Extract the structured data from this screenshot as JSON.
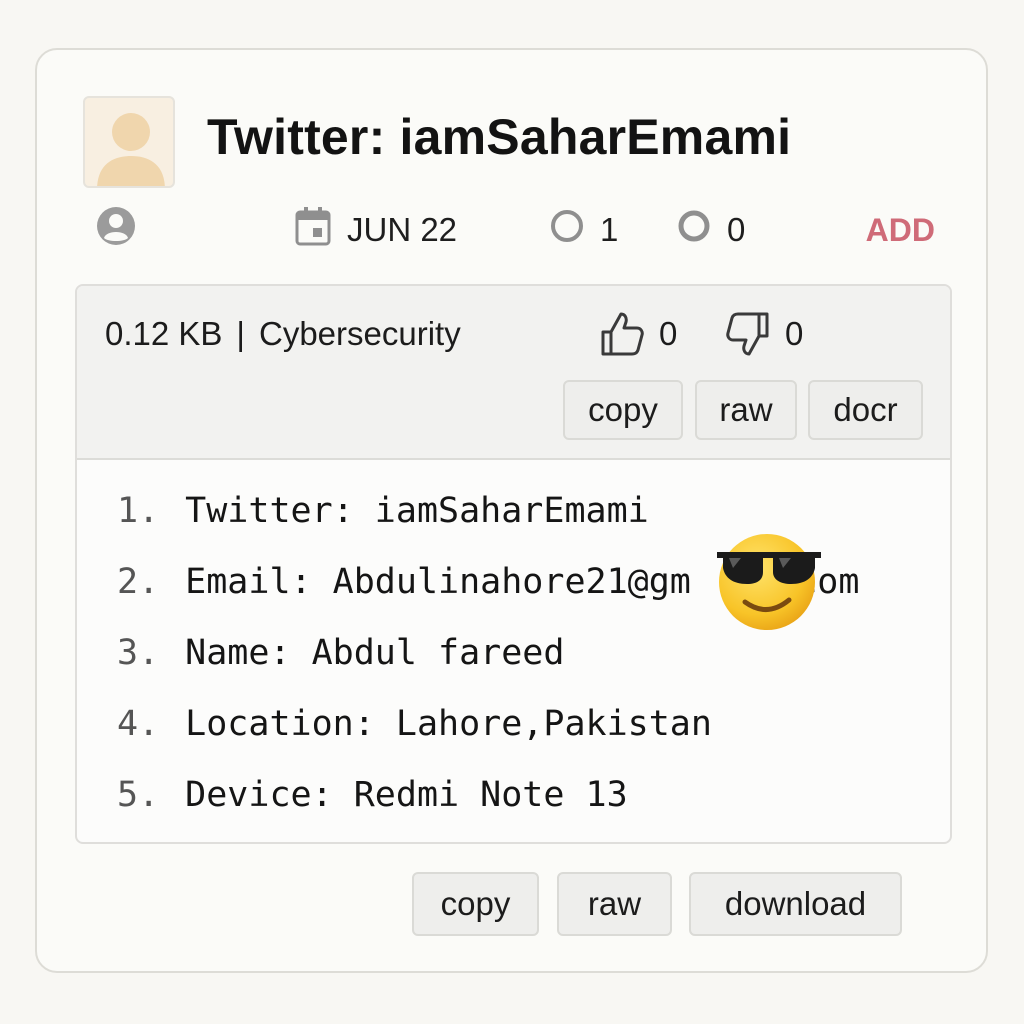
{
  "header": {
    "title": "Twitter: iamSaharEmami"
  },
  "meta": {
    "date": "JUN 22",
    "count_a": "1",
    "count_b": "0",
    "add_label": "ADD"
  },
  "paste": {
    "size": "0.12 KB",
    "separator": "|",
    "category": "Cybersecurity",
    "likes": "0",
    "dislikes": "0",
    "header_buttons": {
      "copy": "copy",
      "raw": "raw",
      "docr": "docr"
    },
    "lines": [
      {
        "num": "1.",
        "text": "Twitter: iamSaharEmami"
      },
      {
        "num": "2.",
        "text": "Email: Abdulinahore21@gm    .com"
      },
      {
        "num": "3.",
        "text": "Name: Abdul fareed"
      },
      {
        "num": "4.",
        "text": "Location: Lahore,Pakistan"
      },
      {
        "num": "5.",
        "text": "Device: Redmi Note 13"
      }
    ]
  },
  "footer_buttons": {
    "copy": "copy",
    "raw": "raw",
    "download": "download"
  },
  "icons": {
    "avatar": "user-avatar-icon",
    "user": "user-circle-icon",
    "date": "calendar-icon",
    "count_a": "circle-icon",
    "count_b": "circle-icon",
    "like": "thumbs-up-icon",
    "dislike": "thumbs-down-icon",
    "overlay": "sunglasses-emoji-icon"
  },
  "colors": {
    "accent": "#cf6b78",
    "avatar_bg": "#f8efe1",
    "avatar_fg": "#f0d6ad"
  }
}
